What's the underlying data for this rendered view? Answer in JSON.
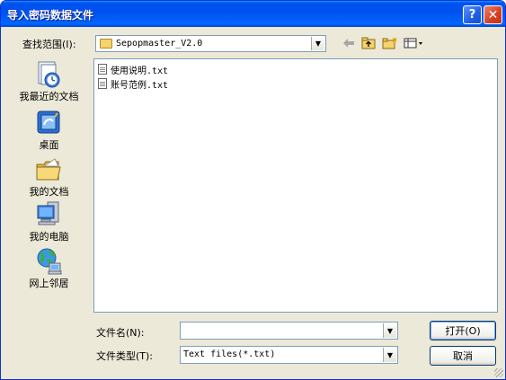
{
  "window": {
    "title": "导入密码数据文件",
    "help_label": "?",
    "close_label": "✕"
  },
  "lookin": {
    "label": "查找范围(I):",
    "value": "Sepopmaster_V2.0"
  },
  "places": [
    {
      "label": "我最近的文档",
      "icon": "recent-docs-icon"
    },
    {
      "label": "桌面",
      "icon": "desktop-icon"
    },
    {
      "label": "我的文档",
      "icon": "my-documents-icon"
    },
    {
      "label": "我的电脑",
      "icon": "my-computer-icon"
    },
    {
      "label": "网上邻居",
      "icon": "network-icon"
    }
  ],
  "files": [
    {
      "name": "使用说明.txt"
    },
    {
      "name": "账号范例.txt"
    }
  ],
  "filename": {
    "label": "文件名(N):",
    "value": ""
  },
  "filetype": {
    "label": "文件类型(T):",
    "value": "Text files(*.txt)"
  },
  "buttons": {
    "open": "打开(O)",
    "cancel": "取消"
  }
}
